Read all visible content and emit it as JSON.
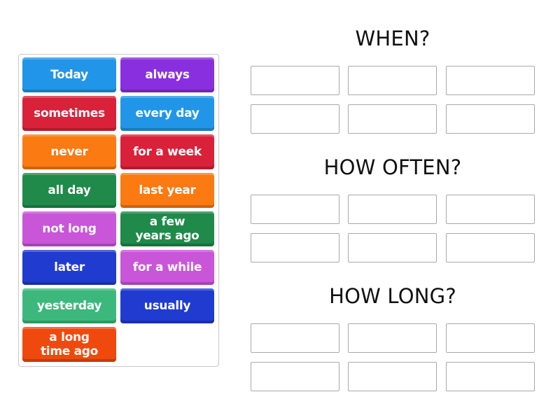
{
  "activity": {
    "type": "group sort",
    "bank": {
      "tiles": [
        {
          "label": "Today",
          "color": "#2196e8"
        },
        {
          "label": "always",
          "color": "#8a2fe0"
        },
        {
          "label": "sometimes",
          "color": "#d9213a"
        },
        {
          "label": "every day",
          "color": "#2196e8"
        },
        {
          "label": "never",
          "color": "#fb7a12"
        },
        {
          "label": "for a week",
          "color": "#d9213a"
        },
        {
          "label": "all day",
          "color": "#1f8a4a"
        },
        {
          "label": "last year",
          "color": "#fb7a12"
        },
        {
          "label": "not long",
          "color": "#c955d8"
        },
        {
          "label": "a few\nyears ago",
          "color": "#1f8a4a"
        },
        {
          "label": "later",
          "color": "#1f3bd0"
        },
        {
          "label": "for a while",
          "color": "#c955d8"
        },
        {
          "label": "yesterday",
          "color": "#3cb87c"
        },
        {
          "label": "usually",
          "color": "#1f3bd0"
        },
        {
          "label": "a long\ntime ago",
          "color": "#f0490e"
        }
      ]
    },
    "groups": [
      {
        "title": "WHEN?",
        "slots": 6
      },
      {
        "title": "HOW OFTEN?",
        "slots": 6
      },
      {
        "title": "HOW LONG?",
        "slots": 6
      }
    ]
  }
}
